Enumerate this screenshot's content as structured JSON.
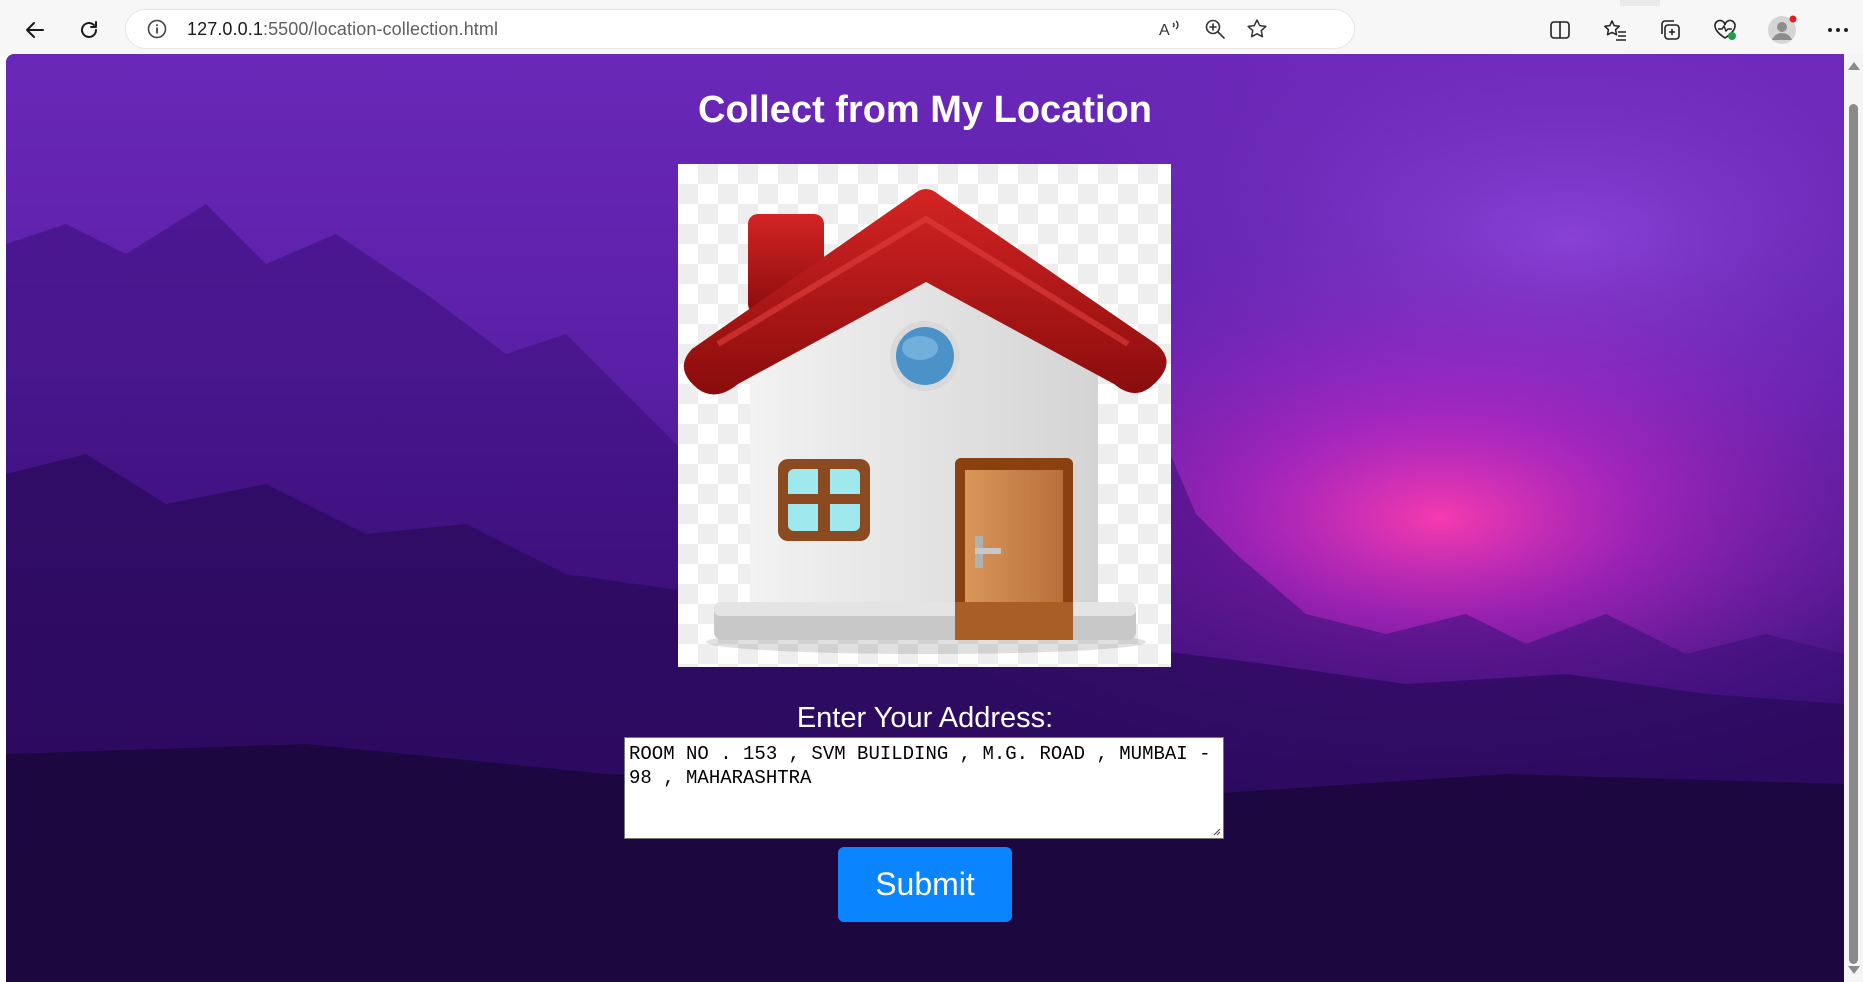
{
  "browser": {
    "url_host": "127.0.0.1",
    "url_rest": ":5500/location-collection.html",
    "back_icon": "back-arrow-icon",
    "reload_icon": "reload-icon",
    "toolbar_icons": [
      "read-aloud-icon",
      "zoom-icon",
      "favorite-star-icon",
      "split-screen-icon",
      "favorites-icon",
      "collections-icon",
      "browser-essentials-icon",
      "profile-avatar-icon",
      "more-options-icon"
    ]
  },
  "page": {
    "title": "Collect from My Location",
    "image_alt": "house-icon",
    "address_label": "Enter Your Address:",
    "address_value": "ROOM NO . 153 , SVM BUILDING , M.G. ROAD , MUMBAI - 98 , MAHARASHTRA",
    "submit_label": "Submit"
  },
  "colors": {
    "background_top": "#6a28b8",
    "background_bottom": "#1a0638",
    "glow": "#ff3cb0",
    "submit": "#0a84ff",
    "roof": "#b01818"
  }
}
